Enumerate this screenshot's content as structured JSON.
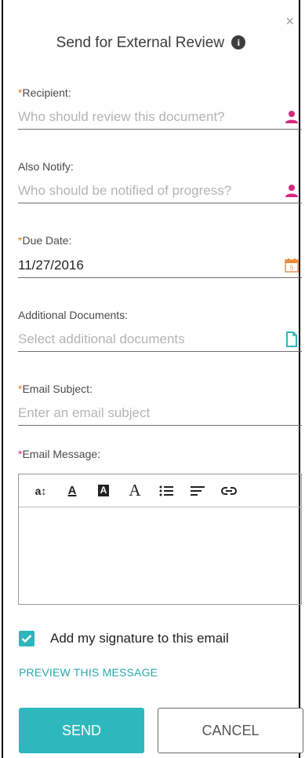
{
  "dialog": {
    "title": "Send for External Review",
    "close_glyph": "×",
    "info_glyph": "i"
  },
  "fields": {
    "recipient": {
      "asterisk": "*",
      "label": "Recipient:",
      "placeholder": "Who should review this document?",
      "icon": "person-icon"
    },
    "also_notify": {
      "label": "Also Notify:",
      "placeholder": "Who should be notified of progress?",
      "icon": "person-icon"
    },
    "due_date": {
      "asterisk": "*",
      "label": "Due Date:",
      "value": "11/27/2016",
      "icon": "calendar-icon",
      "calendar_day": "5"
    },
    "additional_documents": {
      "label": "Additional Documents:",
      "placeholder": "Select additional documents",
      "icon": "document-icon"
    },
    "email_subject": {
      "asterisk": "*",
      "label": "Email Subject:",
      "placeholder": "Enter an email subject"
    },
    "email_message": {
      "asterisk": "*",
      "label": "Email Message:"
    }
  },
  "toolbar": {
    "font_size_glyph": "a↕",
    "text_color_glyph": "A",
    "highlight_glyph": "A",
    "font_family_glyph": "A"
  },
  "signature": {
    "label": "Add my signature to this email",
    "checked": true
  },
  "preview_link": "PREVIEW THIS MESSAGE",
  "buttons": {
    "send": "SEND",
    "cancel": "CANCEL"
  },
  "colors": {
    "accent": "#2eb8bd",
    "required_orange": "#e07a20",
    "required_pink": "#e0287a",
    "person_icon": "#d4297e"
  }
}
